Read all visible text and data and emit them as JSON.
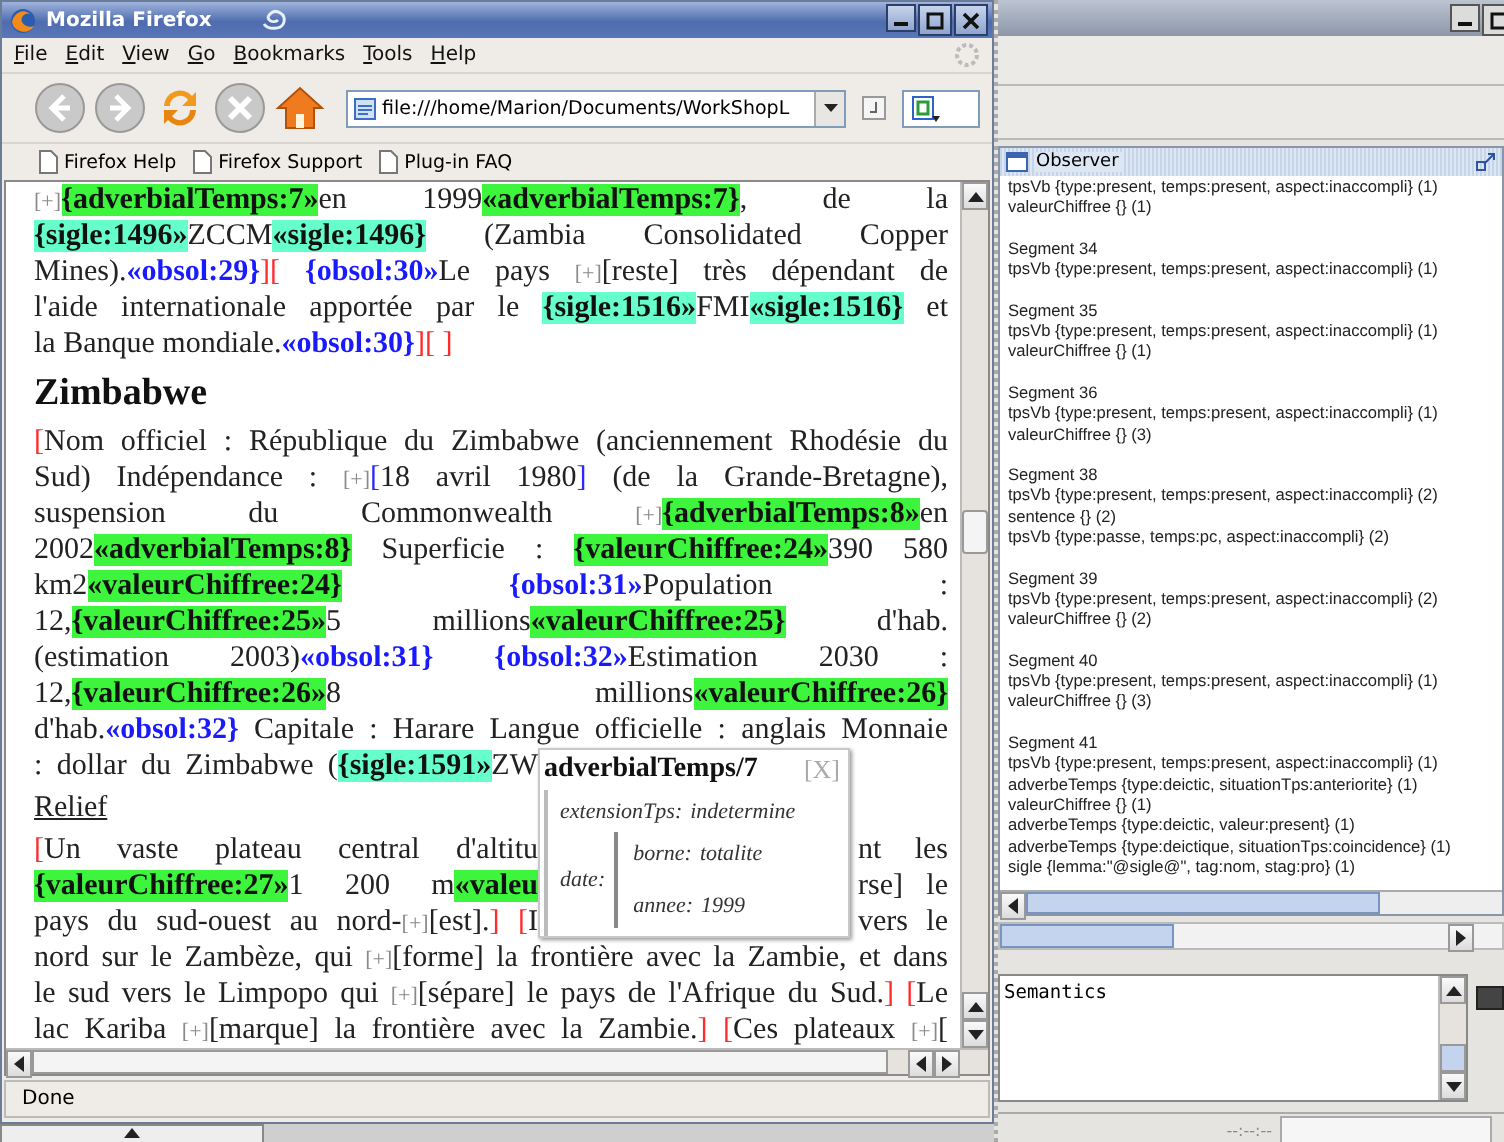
{
  "firefox": {
    "title": "Mozilla Firefox",
    "menu": [
      {
        "label": "File"
      },
      {
        "label": "Edit"
      },
      {
        "label": "View"
      },
      {
        "label": "Go"
      },
      {
        "label": "Bookmarks"
      },
      {
        "label": "Tools"
      },
      {
        "label": "Help"
      }
    ],
    "url": "file:///home/Marion/Documents/WorkShopL",
    "bookmarks": [
      "Firefox Help",
      "Firefox Support",
      "Plug-in FAQ"
    ],
    "status": "Done"
  },
  "document": {
    "blocks": [
      {
        "kind": "para",
        "cut_off": false,
        "lines": [
          {
            "under_popup": false,
            "segments": [
              {
                "kind": "toggle",
                "text": "[+]"
              },
              {
                "kind": "tag-green",
                "text": "{adverbialTemps:7»"
              },
              {
                "kind": "text",
                "text": "en 1999"
              },
              {
                "kind": "tag-green",
                "text": "«adverbialTemps:7}"
              },
              {
                "kind": "text",
                "text": ", de la"
              }
            ]
          },
          {
            "under_popup": false,
            "segments": [
              {
                "kind": "tag-cyan",
                "text": "{sigle:1496»"
              },
              {
                "kind": "text",
                "text": "ZCCM"
              },
              {
                "kind": "tag-cyan",
                "text": "«sigle:1496}"
              },
              {
                "kind": "text",
                "text": " (Zambia Consolidated Copper"
              }
            ]
          },
          {
            "under_popup": false,
            "segments": [
              {
                "kind": "text",
                "text": "Mines)."
              },
              {
                "kind": "obsol",
                "text": "«obsol:29}"
              },
              {
                "kind": "bracket",
                "text": "]["
              },
              {
                "kind": "obsol",
                "text": " {obsol:30»"
              },
              {
                "kind": "text",
                "text": "Le pays "
              },
              {
                "kind": "toggle",
                "text": "[+]"
              },
              {
                "kind": "text",
                "text": "[reste] très dépendant de"
              }
            ]
          },
          {
            "under_popup": false,
            "segments": [
              {
                "kind": "text",
                "text": "l'aide internationale apportée par le "
              },
              {
                "kind": "tag-cyan",
                "text": "{sigle:1516»"
              },
              {
                "kind": "text",
                "text": "FMI"
              },
              {
                "kind": "tag-cyan",
                "text": "«sigle:1516}"
              },
              {
                "kind": "text",
                "text": " et"
              }
            ]
          },
          {
            "under_popup": false,
            "segments": [
              {
                "kind": "text",
                "text": "la Banque mondiale."
              },
              {
                "kind": "obsol",
                "text": "«obsol:30}"
              },
              {
                "kind": "bracket",
                "text": "][ ]"
              }
            ]
          }
        ]
      },
      {
        "kind": "heading",
        "text": "Zimbabwe"
      },
      {
        "kind": "para",
        "cut_off": true,
        "lines": [
          {
            "under_popup": false,
            "segments": [
              {
                "kind": "bracket",
                "text": "["
              },
              {
                "kind": "text",
                "text": "Nom officiel : République du Zimbabwe (anciennement Rhodésie du"
              }
            ]
          },
          {
            "under_popup": false,
            "segments": [
              {
                "kind": "text",
                "text": "Sud) Indépendance : "
              },
              {
                "kind": "toggle",
                "text": "[+]"
              },
              {
                "kind": "bracket-blue",
                "text": "["
              },
              {
                "kind": "text",
                "text": "18 avril 1980"
              },
              {
                "kind": "bracket-blue",
                "text": "]"
              },
              {
                "kind": "text",
                "text": " (de la Grande-Bretagne),"
              }
            ]
          },
          {
            "under_popup": false,
            "segments": [
              {
                "kind": "text",
                "text": "suspension du Commonwealth "
              },
              {
                "kind": "toggle",
                "text": "[+]"
              },
              {
                "kind": "tag-green",
                "text": "{adverbialTemps:8»"
              },
              {
                "kind": "text",
                "text": "en"
              }
            ]
          },
          {
            "under_popup": false,
            "segments": [
              {
                "kind": "text",
                "text": "2002"
              },
              {
                "kind": "tag-green",
                "text": "«adverbialTemps:8}"
              },
              {
                "kind": "text",
                "text": " Superficie : "
              },
              {
                "kind": "tag-green",
                "text": "{valeurChiffree:24»"
              },
              {
                "kind": "text",
                "text": "390 580"
              }
            ]
          },
          {
            "under_popup": false,
            "segments": [
              {
                "kind": "text",
                "text": "km2"
              },
              {
                "kind": "tag-green",
                "text": "«valeurChiffree:24}"
              },
              {
                "kind": "obsol",
                "text": " {obsol:31»"
              },
              {
                "kind": "text",
                "text": "Population :"
              }
            ]
          },
          {
            "under_popup": false,
            "segments": [
              {
                "kind": "text",
                "text": "12,"
              },
              {
                "kind": "tag-green",
                "text": "{valeurChiffree:25»"
              },
              {
                "kind": "text",
                "text": "5 millions"
              },
              {
                "kind": "tag-green",
                "text": "«valeurChiffree:25}"
              },
              {
                "kind": "text",
                "text": " d'hab."
              }
            ]
          },
          {
            "under_popup": false,
            "segments": [
              {
                "kind": "text",
                "text": "(estimation 2003)"
              },
              {
                "kind": "obsol",
                "text": "«obsol:31}"
              },
              {
                "kind": "obsol",
                "text": " {obsol:32»"
              },
              {
                "kind": "text",
                "text": "Estimation 2030 :"
              }
            ]
          },
          {
            "under_popup": false,
            "segments": [
              {
                "kind": "text",
                "text": "12,"
              },
              {
                "kind": "tag-green",
                "text": "{valeurChiffree:26»"
              },
              {
                "kind": "text",
                "text": "8 millions"
              },
              {
                "kind": "tag-green",
                "text": "«valeurChiffree:26}"
              }
            ]
          },
          {
            "under_popup": false,
            "segments": [
              {
                "kind": "text",
                "text": "d'hab."
              },
              {
                "kind": "obsol",
                "text": "«obsol:32}"
              },
              {
                "kind": "text",
                "text": " Capitale : Harare Langue officielle : anglais Monnaie"
              }
            ]
          },
          {
            "under_popup": true,
            "segments": [
              {
                "kind": "text",
                "text": ": dollar du Zimbabwe ("
              },
              {
                "kind": "tag-cyan",
                "text": "{sigle:1591»"
              },
              {
                "kind": "text",
                "text": "ZW"
              }
            ]
          }
        ]
      },
      {
        "kind": "subheading",
        "text": "Relief"
      },
      {
        "kind": "para",
        "cut_off": true,
        "lines": [
          {
            "under_popup": true,
            "segments": [
              {
                "kind": "bracket",
                "text": "["
              },
              {
                "kind": "text",
                "text": "Un vaste plateau central d'altitu"
              }
            ],
            "after": [
              {
                "kind": "text",
                "text": "nt les"
              }
            ]
          },
          {
            "under_popup": true,
            "segments": [
              {
                "kind": "tag-green",
                "text": "{valeurChiffree:27»"
              },
              {
                "kind": "text",
                "text": "1 200 m"
              },
              {
                "kind": "tag-green",
                "text": "«valeu"
              }
            ],
            "after": [
              {
                "kind": "text",
                "text": "rse] le"
              }
            ]
          },
          {
            "under_popup": true,
            "segments": [
              {
                "kind": "text",
                "text": "pays du sud-ouest au nord-"
              },
              {
                "kind": "toggle",
                "text": "[+]"
              },
              {
                "kind": "text",
                "text": "[est]."
              },
              {
                "kind": "bracket",
                "text": "] ["
              },
              {
                "kind": "text",
                "text": "I"
              }
            ],
            "after": [
              {
                "kind": "text",
                "text": "vers le"
              }
            ]
          },
          {
            "under_popup": false,
            "segments": [
              {
                "kind": "text",
                "text": "nord sur le Zambèze, qui "
              },
              {
                "kind": "toggle",
                "text": "[+]"
              },
              {
                "kind": "text",
                "text": "[forme] la frontière avec la Zambie, et dans"
              }
            ]
          },
          {
            "under_popup": false,
            "segments": [
              {
                "kind": "text",
                "text": "le sud vers le Limpopo qui "
              },
              {
                "kind": "toggle",
                "text": "[+]"
              },
              {
                "kind": "text",
                "text": "[sépare] le pays de l'Afrique du Sud."
              },
              {
                "kind": "bracket",
                "text": "] ["
              },
              {
                "kind": "text",
                "text": "Le"
              }
            ]
          },
          {
            "under_popup": false,
            "segments": [
              {
                "kind": "text",
                "text": "lac Kariba "
              },
              {
                "kind": "toggle",
                "text": "[+]"
              },
              {
                "kind": "text",
                "text": "[marque] la frontière avec la Zambie."
              },
              {
                "kind": "bracket",
                "text": "] ["
              },
              {
                "kind": "text",
                "text": "Ces plateaux "
              },
              {
                "kind": "toggle",
                "text": "[+]"
              },
              {
                "kind": "text",
                "text": "["
              }
            ]
          }
        ]
      }
    ]
  },
  "popup": {
    "title": "adverbialTemps/7",
    "close": "[X]",
    "features": [
      {
        "name": "extensionTps:",
        "value": "indetermine"
      },
      {
        "name": "date:",
        "children": [
          {
            "name": "borne:",
            "value": "totalite"
          },
          {
            "name": "annee:",
            "value": "1999"
          }
        ]
      }
    ]
  },
  "observer": {
    "title": "Observer",
    "lead": [
      "tpsVb {type:present, temps:present, aspect:inaccompli} (1)",
      "valeurChiffree {} (1)"
    ],
    "segments": [
      {
        "title": "Segment 34",
        "lines": [
          "tpsVb {type:present, temps:present, aspect:inaccompli} (1)"
        ]
      },
      {
        "title": "Segment 35",
        "lines": [
          "tpsVb {type:present, temps:present, aspect:inaccompli} (1)",
          "valeurChiffree {} (1)"
        ]
      },
      {
        "title": "Segment 36",
        "lines": [
          "tpsVb {type:present, temps:present, aspect:inaccompli} (1)",
          "valeurChiffree {} (3)"
        ]
      },
      {
        "title": "Segment 38",
        "lines": [
          "tpsVb {type:present, temps:present, aspect:inaccompli} (2)",
          "sentence {} (2)",
          "tpsVb {type:passe, temps:pc, aspect:inaccompli} (2)"
        ]
      },
      {
        "title": "Segment 39",
        "lines": [
          "tpsVb {type:present, temps:present, aspect:inaccompli} (2)",
          "valeurChiffree {} (2)"
        ]
      },
      {
        "title": "Segment 40",
        "lines": [
          "tpsVb {type:present, temps:present, aspect:inaccompli} (1)",
          "valeurChiffree {} (3)"
        ]
      },
      {
        "title": "Segment 41",
        "lines": [
          "tpsVb {type:present, temps:present, aspect:inaccompli} (1)",
          "adverbeTemps {type:deictic, situationTps:anteriorite} (1)",
          "valeurChiffree {} (1)",
          "adverbeTemps {type:deictic, valeur:present} (1)",
          "adverbeTemps {type:deictique, situationTps:coincidence} (1)",
          "sigle {lemma:\"@sigle@\", tag:nom, stag:pro} (1)"
        ]
      }
    ]
  },
  "semantics": {
    "text": "Semantics"
  },
  "status_bar": {
    "time": "--:--:--"
  }
}
